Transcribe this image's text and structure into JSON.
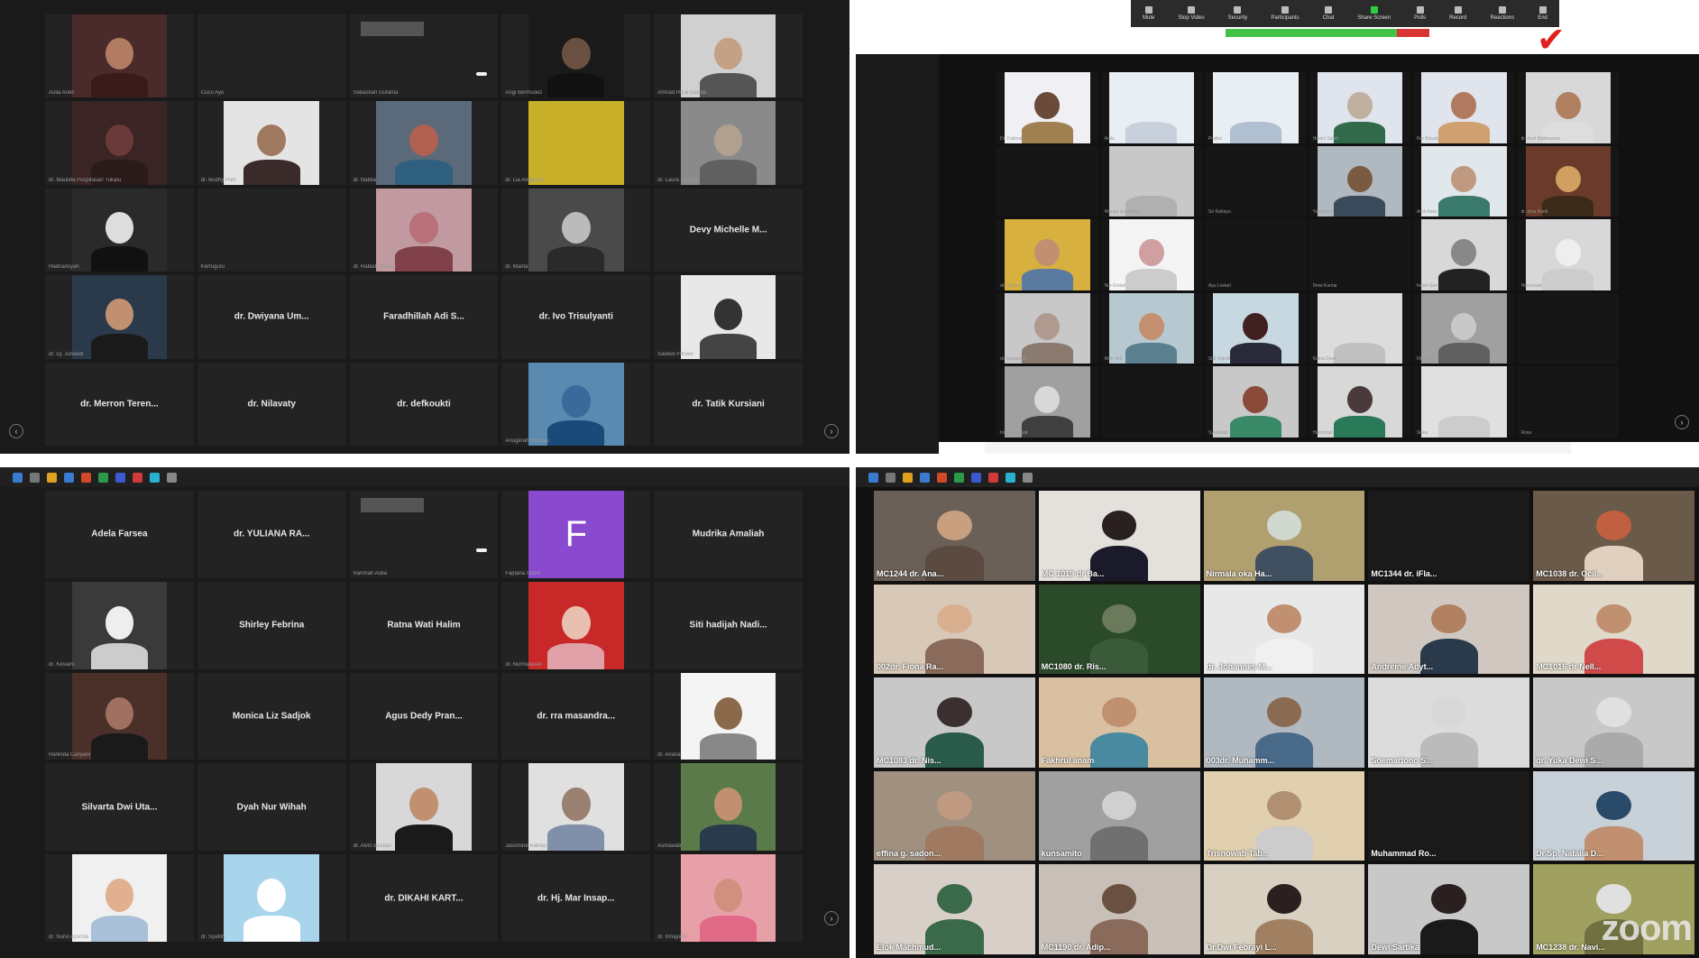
{
  "top_left": {
    "tiles": [
      {
        "caption": "Aulia Arieli",
        "label": "",
        "video": true,
        "bg": "#4a2a2a",
        "face": "#b27c62",
        "shirt": "#3a1a1a"
      },
      {
        "caption": "Cucu Ayu",
        "label": "",
        "video": false
      },
      {
        "caption": "Sebastian Gutama",
        "label": "",
        "video": false,
        "invite": true
      },
      {
        "caption": "Angi Bermudez",
        "label": "",
        "video": true,
        "bg": "#1a1a1a",
        "face": "#6a5040",
        "shirt": "#111"
      },
      {
        "caption": "Ahmad Rizal Ganda",
        "label": "",
        "video": true,
        "bg": "#d0d0d0",
        "face": "#c4a084",
        "shirt": "#555"
      },
      {
        "caption": "dr. Maulida Puspitasari Tukalu",
        "label": "",
        "video": true,
        "bg": "#3a2424",
        "face": "#6a3a3a",
        "shirt": "#2a1a1a"
      },
      {
        "caption": "dr. Budhy Putri",
        "label": "",
        "video": true,
        "bg": "#e4e4e4",
        "face": "#a07a60",
        "shirt": "#3a2a2a"
      },
      {
        "caption": "dr. Nabila",
        "label": "",
        "video": true,
        "bg": "#5a6a7a",
        "face": "#b06050",
        "shirt": "#306080"
      },
      {
        "caption": "dr. Lia Anggraini",
        "label": "",
        "video": true,
        "bg": "#c8b02a",
        "face": "#c8b02a",
        "shirt": "#c8b02a"
      },
      {
        "caption": "dr. Laura Ceicilia",
        "label": "",
        "video": true,
        "bg": "#8a8a8a",
        "face": "#b0a090",
        "shirt": "#606060"
      },
      {
        "caption": "Hadriansyah",
        "label": "",
        "video": true,
        "bg": "#2a2a2a",
        "face": "#ddd",
        "shirt": "#111"
      },
      {
        "caption": "Kertuguru",
        "label": "",
        "video": false
      },
      {
        "caption": "dr. Rabiah Waleni",
        "label": "",
        "video": true,
        "bg": "#c09aa0",
        "face": "#b8707a",
        "shirt": "#80404a"
      },
      {
        "caption": "dr. Marita",
        "label": "",
        "video": true,
        "bg": "#4a4a4a",
        "face": "#bbb",
        "shirt": "#2a2a2a"
      },
      {
        "caption": "",
        "label": "Devy Michelle M...",
        "video": false
      },
      {
        "caption": "dr. Dj. Junaedi",
        "label": "",
        "video": true,
        "bg": "#2a3a4a",
        "face": "#c09070",
        "shirt": "#1a1a1a"
      },
      {
        "caption": "",
        "label": "dr. Dwiyana Um...",
        "video": false
      },
      {
        "caption": "",
        "label": "Faradhillah Adi S...",
        "video": false
      },
      {
        "caption": "",
        "label": "dr. Ivo Trisulyanti",
        "video": false
      },
      {
        "caption": "Sadewi Fitriani",
        "label": "",
        "video": true,
        "bg": "#e8e8e8",
        "face": "#333",
        "shirt": "#444"
      },
      {
        "caption": "",
        "label": "dr. Merron Teren...",
        "video": false
      },
      {
        "caption": "",
        "label": "dr. Nilavaty",
        "video": false
      },
      {
        "caption": "",
        "label": "dr. defkoukti",
        "video": false
      },
      {
        "caption": "Anugerah Rahayu",
        "label": "",
        "video": true,
        "bg": "#5a8ab0",
        "face": "#3a6a9a",
        "shirt": "#1a4a7a"
      },
      {
        "caption": "",
        "label": "dr. Tatik Kursiani",
        "video": false
      }
    ]
  },
  "bottom_left": {
    "tiles": [
      {
        "caption": "",
        "label": "Adela Farsea",
        "video": false
      },
      {
        "caption": "",
        "label": "dr. YULIANA RA...",
        "video": false
      },
      {
        "caption": "Rahmah Aulia",
        "label": "",
        "video": false,
        "invite": true
      },
      {
        "caption": "Fajriana Utami",
        "label": "",
        "video": false,
        "letter": "F"
      },
      {
        "caption": "",
        "label": "Mudrika Amaliah",
        "video": false
      },
      {
        "caption": "dr. Kesiani",
        "label": "",
        "video": true,
        "bg": "#3a3a3a",
        "face": "#eeeeee",
        "shirt": "#cccccc"
      },
      {
        "caption": "",
        "label": "Shirley Febrina",
        "video": false
      },
      {
        "caption": "",
        "label": "Ratna Wati Halim",
        "video": false
      },
      {
        "caption": "dr. Nurmalasari",
        "label": "",
        "video": true,
        "bg": "#c82828",
        "face": "#e8c0b0",
        "shirt": "#e0a0a8"
      },
      {
        "caption": "",
        "label": "Siti hadijah Nadi...",
        "video": false
      },
      {
        "caption": "Harlinda Cahyani",
        "label": "",
        "video": true,
        "bg": "#4a3028",
        "face": "#a07060",
        "shirt": "#1a1a1a"
      },
      {
        "caption": "",
        "label": "Monica Liz Sadjok",
        "video": false
      },
      {
        "caption": "",
        "label": "Agus Dedy Pran...",
        "video": false
      },
      {
        "caption": "",
        "label": "dr. rra masandra...",
        "video": false
      },
      {
        "caption": "dr. Ariana",
        "label": "",
        "video": true,
        "bg": "#f4f4f4",
        "face": "#8a6a4a",
        "shirt": "#888"
      },
      {
        "caption": "",
        "label": "Silvarta Dwi Uta...",
        "video": false
      },
      {
        "caption": "",
        "label": "Dyah Nur Wihah",
        "video": false
      },
      {
        "caption": "dr. Alvin Bastian",
        "label": "",
        "video": true,
        "bg": "#d8d8d8",
        "face": "#c09070",
        "shirt": "#1a1a1a"
      },
      {
        "caption": "Jassmine Rahayu",
        "label": "",
        "video": true,
        "bg": "#e0e0e0",
        "face": "#9a8070",
        "shirt": "#8090a8"
      },
      {
        "caption": "Asmawati",
        "label": "",
        "video": true,
        "bg": "#5a7a4a",
        "face": "#c09070",
        "shirt": "#2a3a4a"
      },
      {
        "caption": "dr. Nurul Ayunda",
        "label": "",
        "video": true,
        "bg": "#f0f0f0",
        "face": "#e0b090",
        "shirt": "#a8c0d8"
      },
      {
        "caption": "dr. Syafitri",
        "label": "",
        "video": true,
        "bg": "#a8d4ec",
        "face": "#ffffff",
        "shirt": "#ffffff"
      },
      {
        "caption": "",
        "label": "dr. DIKAHI KART...",
        "video": false
      },
      {
        "caption": "",
        "label": "dr. Hj. Mar Insap...",
        "video": false
      },
      {
        "caption": "dr. Irmayanti",
        "label": "",
        "video": true,
        "bg": "#e8a0a8",
        "face": "#d09080",
        "shirt": "#e06a88"
      }
    ]
  },
  "top_right": {
    "toolbar": [
      "Mute",
      "Stop Video",
      "Security",
      "Participants",
      "Chat",
      "Share Screen",
      "Polls",
      "Record",
      "Reactions",
      "End"
    ],
    "tiles": [
      {
        "caption": "Dr. Fatimah",
        "bg": "#f0f0f4",
        "face": "#6a4a3a",
        "shirt": "#a08050"
      },
      {
        "caption": "Anita",
        "bg": "#e8eef4",
        "face": "#e8eef4",
        "shirt": "#c8d0dc"
      },
      {
        "caption": "Pratiwi",
        "bg": "#e8eef4",
        "face": "#e8eef4",
        "shirt": "#b0c0d0"
      },
      {
        "caption": "Hartini Saleh",
        "bg": "#e0e4ec",
        "face": "#c0b0a0",
        "shirt": "#306a4a"
      },
      {
        "caption": "Nur Aisyah",
        "bg": "#e0e4ec",
        "face": "#b07a60",
        "shirt": "#d0a070"
      },
      {
        "caption": "dr. Andi Makkawaru",
        "bg": "#d8d8d8",
        "face": "#b08060",
        "shirt": "#ddd"
      },
      {
        "caption": "",
        "bg": "#161616",
        "face": "#161616",
        "shirt": "#161616"
      },
      {
        "caption": "Ahmad Soebandi",
        "bg": "#c8c8c8",
        "face": "#c8c8c8",
        "shirt": "#b0b0b0"
      },
      {
        "caption": "Sri Rahayu",
        "bg": "#161616",
        "face": "#161616",
        "shirt": "#161616"
      },
      {
        "caption": "Yudhistira",
        "bg": "#b0b8c0",
        "face": "#7a5a40",
        "shirt": "#3a4a5a"
      },
      {
        "caption": "Andi Baso",
        "bg": "#e0e8ec",
        "face": "#c09a80",
        "shirt": "#3a7a6a"
      },
      {
        "caption": "dr. Irma Ranti",
        "bg": "#6a3a2a",
        "face": "#d0a060",
        "shirt": "#3a2a1a"
      },
      {
        "caption": "dr. Sakinah",
        "bg": "#d8b040",
        "face": "#c09070",
        "shirt": "#5a7aa0"
      },
      {
        "caption": "Nur Endah",
        "bg": "#f4f4f4",
        "face": "#d0a0a0",
        "shirt": "#cccccc"
      },
      {
        "caption": "Ayu Lestari",
        "bg": "#161616",
        "face": "#161616",
        "shirt": "#161616"
      },
      {
        "caption": "Dewi Kurnia",
        "bg": "#161616",
        "face": "#161616",
        "shirt": "#161616"
      },
      {
        "caption": "Indah Sari",
        "bg": "#d8d8d8",
        "face": "#888",
        "shirt": "#222"
      },
      {
        "caption": "Hasnawati",
        "bg": "#d8d8d8",
        "face": "#eee",
        "shirt": "#ccc"
      },
      {
        "caption": "dr. Nurjannah",
        "bg": "#c8c8c8",
        "face": "#b09a90",
        "shirt": "#8a7a70"
      },
      {
        "caption": "Muh. Arif",
        "bg": "#b8c8d0",
        "face": "#c49070",
        "shirt": "#5a8090"
      },
      {
        "caption": "Sitti Hajrah",
        "bg": "#c8d8e0",
        "face": "#402020",
        "shirt": "#2a2a3a"
      },
      {
        "caption": "Ratna Dewi",
        "bg": "#dcdcdc",
        "face": "#dcdcdc",
        "shirt": "#c0c0c0"
      },
      {
        "caption": "Fitriani",
        "bg": "#a0a0a0",
        "face": "#c8c8c8",
        "shirt": "#606060"
      },
      {
        "caption": "",
        "bg": "#161616",
        "face": "#161616",
        "shirt": "#161616"
      },
      {
        "caption": "Irwan Hidayat",
        "bg": "#a0a0a0",
        "face": "#d8d8d8",
        "shirt": "#404040"
      },
      {
        "caption": "",
        "bg": "#161616",
        "face": "#161616",
        "shirt": "#161616"
      },
      {
        "caption": "Syamsiah",
        "bg": "#c8c8c8",
        "face": "#8a4a3a",
        "shirt": "#3a8a6a"
      },
      {
        "caption": "Hamsinah",
        "bg": "#d8d8d8",
        "face": "#4a3a3a",
        "shirt": "#2a7a5a"
      },
      {
        "caption": "Siska",
        "bg": "#e0e0e0",
        "face": "#e0e0e0",
        "shirt": "#cccccc"
      },
      {
        "caption": "Rosa",
        "bg": "#161616",
        "face": "#161616",
        "shirt": "#161616"
      }
    ]
  },
  "bottom_right": {
    "tiles": [
      {
        "name": "MC1244 dr. Ana...",
        "bg": "#6a6058",
        "head": "#c8a080",
        "body": "#5a4a40"
      },
      {
        "name": "MC 1019 dr Ba...",
        "bg": "#e4e0dc",
        "head": "#2a2020",
        "body": "#1a1a2a"
      },
      {
        "name": "Nirmala oka Ha...",
        "bg": "#b0a070",
        "head": "#d0d8d0",
        "body": "#405060"
      },
      {
        "name": "MC1344 dr. iFla...",
        "bg": "#1a1a1a",
        "head": "#1a1a1a",
        "body": "#1a1a1a"
      },
      {
        "name": "MC1038 dr. Ocil...",
        "bg": "#6a5a4a",
        "head": "#c06040",
        "body": "#e0d0c0"
      },
      {
        "name": "002dr. Fiona Ra...",
        "bg": "#d8c8b8",
        "head": "#d8b090",
        "body": "#8a6a5a"
      },
      {
        "name": "MC1080 dr. Ris...",
        "bg": "#2a4a2a",
        "head": "#6a7a5a",
        "body": "#3a5a3a"
      },
      {
        "name": "dr. Johannes M...",
        "bg": "#e8e8e8",
        "head": "#c09070",
        "body": "#f0f0f0"
      },
      {
        "name": "Andreine Adyt...",
        "bg": "#d0c8c0",
        "head": "#b08060",
        "body": "#2a3a4a"
      },
      {
        "name": "MC1016 dr Nell...",
        "bg": "#e0d8c8",
        "head": "#c09070",
        "body": "#d04a4a"
      },
      {
        "name": "MC1083 dr. Nis...",
        "bg": "#c8c8c8",
        "head": "#3a3030",
        "body": "#2a5a4a"
      },
      {
        "name": "Fakhrul anam",
        "bg": "#d8c0a0",
        "head": "#c09070",
        "body": "#4a8aa0"
      },
      {
        "name": "003dr. Muhamm...",
        "bg": "#b0b8c0",
        "head": "#8a6a50",
        "body": "#4a6a8a"
      },
      {
        "name": "Soemartono S...",
        "bg": "#dcdcdc",
        "head": "#d8d8d8",
        "body": "#bbbbbb"
      },
      {
        "name": "dr. Yuka Dewi S...",
        "bg": "#c8c8c8",
        "head": "#e0e0e0",
        "body": "#aaaaaa"
      },
      {
        "name": "effina g. sadon...",
        "bg": "#a09080",
        "head": "#c09a80",
        "body": "#a07a60"
      },
      {
        "name": "kunsamito",
        "bg": "#a0a0a0",
        "head": "#d0d0d0",
        "body": "#707070"
      },
      {
        "name": "Trisnowati Tab...",
        "bg": "#e0d0b0",
        "head": "#b09070",
        "body": "#cccccc"
      },
      {
        "name": "Muhammad Ro...",
        "bg": "#1a1a1a",
        "head": "#1a1a1a",
        "body": "#1a1a1a"
      },
      {
        "name": "Dr.Sp. Natalia D...",
        "bg": "#c8d0d8",
        "head": "#2a4a6a",
        "body": "#c09070",
        "active": true
      },
      {
        "name": "Elok Machmud...",
        "bg": "#d8d0c8",
        "head": "#3a6a4a",
        "body": "#3a6a4a"
      },
      {
        "name": "MC1190 dr. Adip...",
        "bg": "#c8c0b8",
        "head": "#6a5040",
        "body": "#8a6a5a"
      },
      {
        "name": "Dr.Dwi Febrayi L...",
        "bg": "#d8d0c0",
        "head": "#2a2020",
        "body": "#a08060"
      },
      {
        "name": "Dewi Sartika",
        "bg": "#c8c8c8",
        "head": "#2a2020",
        "body": "#1a1a1a"
      },
      {
        "name": "MC1238 dr. Navi...",
        "bg": "#a0a060",
        "head": "#e0e0e0",
        "body": "#707040"
      }
    ],
    "zoom_logo": "zoom"
  }
}
